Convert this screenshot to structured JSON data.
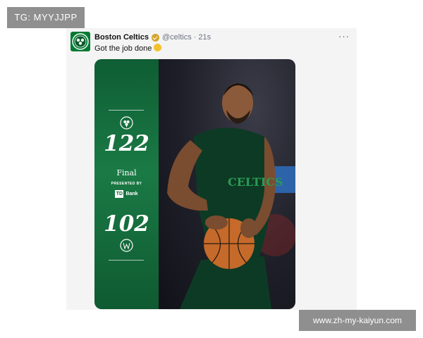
{
  "watermarks": {
    "top_left": "TG: MYYJJPP",
    "bottom_right": "www.zh-my-kaiyun.com"
  },
  "tweet": {
    "author_name": "Boston Celtics",
    "handle": "@celtics",
    "separator": "·",
    "time": "21s",
    "text": "Got the job done",
    "more_label": "···"
  },
  "media": {
    "home_score": "122",
    "status": "Final",
    "presented_by": "PRESENTED BY",
    "sponsor": "Bank",
    "sponsor_logo": "TD",
    "away_score": "102",
    "jersey_text": "CELTICS"
  },
  "colors": {
    "celtics_green": "#007a33",
    "panel_green": "#1a7a45",
    "verified_gold": "#d4a52a"
  },
  "icons": {
    "avatar": "celtics-logo-icon",
    "verified": "verified-badge-icon",
    "emoji": "pleading-face-emoji",
    "home_logo": "celtics-clover-icon",
    "away_logo": "wizards-logo-icon",
    "more": "more-options-icon"
  }
}
